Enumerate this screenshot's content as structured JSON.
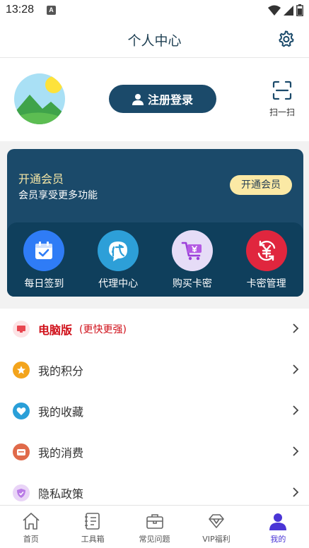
{
  "status_bar": {
    "time": "13:28",
    "notification_badge": "A"
  },
  "header": {
    "title": "个人中心",
    "settings_icon": "gear-icon"
  },
  "profile": {
    "avatar_icon": "landscape-avatar-icon",
    "login_label": "注册登录",
    "scan_label": "扫一扫"
  },
  "vip": {
    "title": "开通会员",
    "subtitle": "会员享受更多功能",
    "open_button": "开通会员",
    "actions": [
      {
        "label": "每日签到",
        "icon": "calendar-check-icon",
        "color": "#2f7cf6"
      },
      {
        "label": "代理中心",
        "icon": "agent-icon",
        "color": "#2d9fd8"
      },
      {
        "label": "购买卡密",
        "icon": "shopping-cart-icon",
        "color": "#e6dcf7"
      },
      {
        "label": "卡密管理",
        "icon": "yen-refresh-icon",
        "color": "#e0263e"
      }
    ]
  },
  "menu": {
    "items": [
      {
        "label": "电脑版",
        "sub": "(更快更强)",
        "icon": "desktop-icon",
        "color": "#e8464f"
      },
      {
        "label": "我的积分",
        "icon": "star-icon",
        "color": "#f3a41c"
      },
      {
        "label": "我的收藏",
        "icon": "heart-icon",
        "color": "#2a9fd8"
      },
      {
        "label": "我的消费",
        "icon": "wallet-icon",
        "color": "#e06a4a"
      },
      {
        "label": "隐私政策",
        "icon": "shield-icon",
        "color": "#b97be6"
      }
    ]
  },
  "tabbar": {
    "tabs": [
      {
        "label": "首页",
        "icon": "home-icon"
      },
      {
        "label": "工具箱",
        "icon": "notebook-icon"
      },
      {
        "label": "常见问题",
        "icon": "briefcase-icon"
      },
      {
        "label": "VIP福利",
        "icon": "diamond-icon"
      },
      {
        "label": "我的",
        "icon": "user-icon",
        "active": true
      }
    ]
  },
  "colors": {
    "primary": "#1b4a6a",
    "gold": "#f6e7a6",
    "active_tab": "#4a35d6",
    "red": "#d0101a"
  }
}
